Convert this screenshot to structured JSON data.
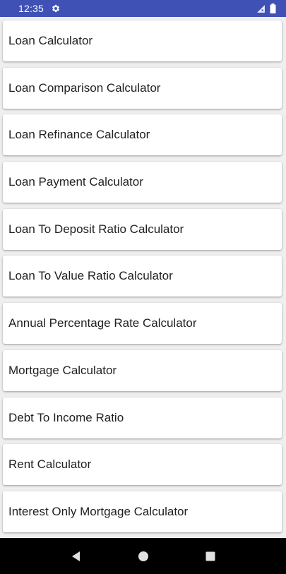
{
  "status_bar": {
    "time": "12:35",
    "background_color": "#3f51b5",
    "icons": [
      "settings-gear-icon",
      "signal-icon",
      "battery-icon"
    ]
  },
  "list": {
    "items": [
      {
        "label": "Loan Calculator"
      },
      {
        "label": "Loan Comparison Calculator"
      },
      {
        "label": "Loan Refinance Calculator"
      },
      {
        "label": "Loan Payment Calculator"
      },
      {
        "label": "Loan To Deposit Ratio Calculator"
      },
      {
        "label": "Loan To Value Ratio Calculator"
      },
      {
        "label": "Annual Percentage Rate Calculator"
      },
      {
        "label": "Mortgage Calculator"
      },
      {
        "label": "Debt To Income Ratio"
      },
      {
        "label": "Rent Calculator"
      },
      {
        "label": "Interest Only Mortgage Calculator"
      }
    ]
  },
  "nav_bar": {
    "icons": [
      "back-icon",
      "home-icon",
      "recents-icon"
    ]
  }
}
